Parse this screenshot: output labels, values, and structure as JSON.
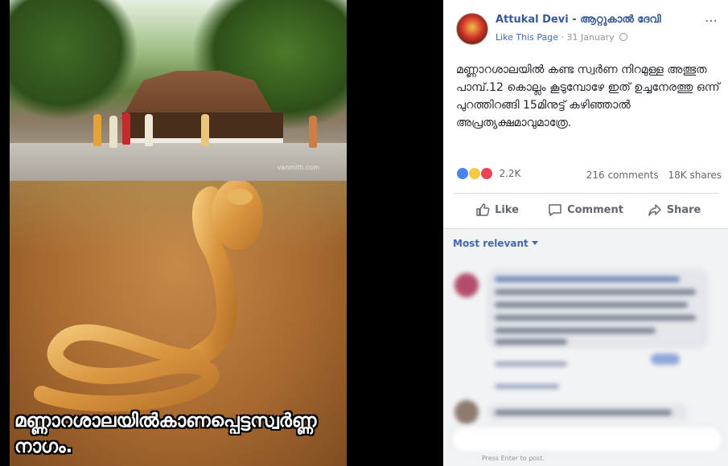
{
  "photo": {
    "watermark": "vanmith.com",
    "caption": "മണ്ണാറശാലയിൽകാണപ്പെട്ടസ്വർണ്ണ നാഗം."
  },
  "post": {
    "page_name": "Attukal Devi - ആറ്റുകാൽ ദേവി",
    "like_link": "Like This Page",
    "separator": "·",
    "date": "31 January",
    "more_icon": "⋯",
    "text": "മണ്ണാറശാലയിൽ കണ്ട സ്വർണ നിറമുള്ള അത്ഭുത പാമ്പ്.12 കൊല്ലം കൂടുമ്പോഴേ ഇത് ഉച്ചനേരത്തു ഒന്ന് പുറത്തിറങ്ങി 15മിനുട്ട് കഴിഞ്ഞാൽ അപ്രത്യക്ഷമാവുമാത്രേ.",
    "reactions_count": "2.2K",
    "comments": "216 comments",
    "shares": "18K shares",
    "actions": {
      "like": "Like",
      "comment": "Comment",
      "share": "Share"
    },
    "sort_label": "Most relevant",
    "composer_hint": "Press Enter to post.",
    "colors": {
      "link": "#365899",
      "accent": "#4267b2",
      "muted": "#90949c",
      "text": "#1d2129"
    }
  }
}
